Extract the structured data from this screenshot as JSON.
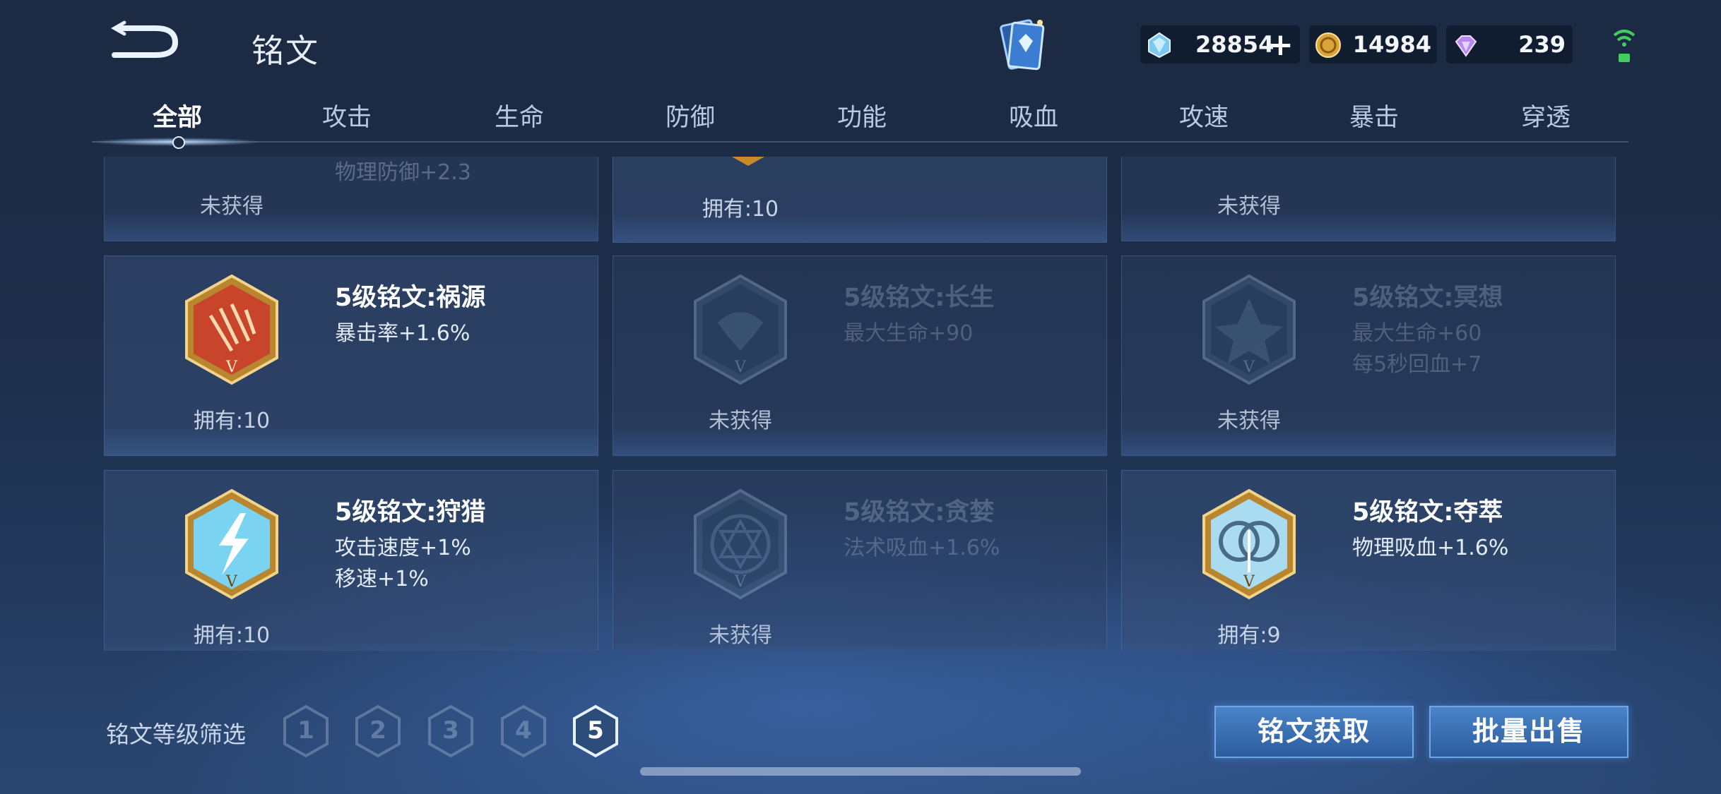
{
  "header": {
    "title": "铭文",
    "currency": [
      {
        "name": "diamond",
        "value": "28854",
        "icon": "diamond-icon",
        "plus": "+"
      },
      {
        "name": "gold",
        "value": "14984",
        "icon": "gold-coin-icon"
      },
      {
        "name": "crystal",
        "value": "239",
        "icon": "crystal-icon"
      }
    ]
  },
  "tabs": [
    "全部",
    "攻击",
    "生命",
    "防御",
    "功能",
    "吸血",
    "攻速",
    "暴击",
    "穿透"
  ],
  "active_tab": "全部",
  "partial_row": [
    {
      "stat1": "物理防御+2.3",
      "status": "未获得",
      "owned": false
    },
    {
      "status": "拥有:10",
      "owned": true
    },
    {
      "status": "未获得",
      "owned": false
    }
  ],
  "rows": [
    [
      {
        "name": "5级铭文:祸源",
        "stat1": "暴击率+1.6%",
        "stat2": "",
        "status": "拥有:10",
        "owned": true,
        "color": "#c8442a",
        "icon": "inscription-huoyuan-icon"
      },
      {
        "name": "5级铭文:长生",
        "stat1": "最大生命+90",
        "stat2": "",
        "status": "未获得",
        "owned": false,
        "color": "#3a5a78",
        "icon": "inscription-changsheng-icon"
      },
      {
        "name": "5级铭文:冥想",
        "stat1": "最大生命+60",
        "stat2": "每5秒回血+7",
        "status": "未获得",
        "owned": false,
        "color": "#3a5a78",
        "icon": "inscription-mingxiang-icon"
      }
    ],
    [
      {
        "name": "5级铭文:狩猎",
        "stat1": "攻击速度+1%",
        "stat2": "移速+1%",
        "status": "拥有:10",
        "owned": true,
        "color": "#7ad3f0",
        "icon": "inscription-shoulie-icon"
      },
      {
        "name": "5级铭文:贪婪",
        "stat1": "法术吸血+1.6%",
        "stat2": "",
        "status": "未获得",
        "owned": false,
        "color": "#3a5a78",
        "icon": "inscription-tanlan-icon"
      },
      {
        "name": "5级铭文:夺萃",
        "stat1": "物理吸血+1.6%",
        "stat2": "",
        "status": "拥有:9",
        "owned": true,
        "color": "#a9dcf0",
        "icon": "inscription-duocui-icon"
      }
    ]
  ],
  "footer": {
    "filter_label": "铭文等级筛选",
    "levels": [
      "1",
      "2",
      "3",
      "4",
      "5"
    ],
    "active_level": "5",
    "acquire_label": "铭文获取",
    "sell_label": "批量出售"
  }
}
